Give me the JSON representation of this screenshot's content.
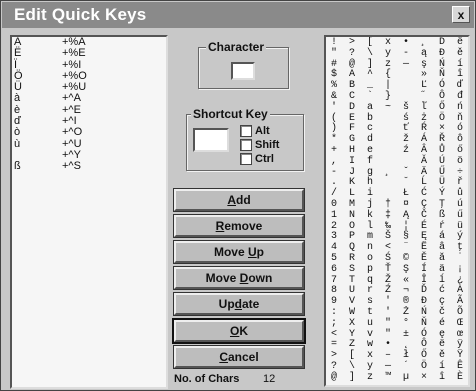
{
  "window": {
    "title": "Edit Quick Keys",
    "close_glyph": "x"
  },
  "quick_keys": [
    {
      "char": "Ä",
      "code": "+%A"
    },
    {
      "char": "Ë",
      "code": "+%E"
    },
    {
      "char": "Ï",
      "code": "+%I"
    },
    {
      "char": "Ö",
      "code": "+%O"
    },
    {
      "char": "Ü",
      "code": "+%U"
    },
    {
      "char": "à",
      "code": "+^A"
    },
    {
      "char": "è",
      "code": "+^E"
    },
    {
      "char": "ď",
      "code": "+^I"
    },
    {
      "char": "ò",
      "code": "+^O"
    },
    {
      "char": "ù",
      "code": "+^U"
    },
    {
      "char": "",
      "code": "+^Y"
    },
    {
      "char": "ß",
      "code": "+^S"
    }
  ],
  "character_group": {
    "label": "Character",
    "value": ""
  },
  "shortcut_group": {
    "label": "Shortcut Key",
    "value": "",
    "checkboxes": [
      {
        "label": "Alt",
        "checked": false
      },
      {
        "label": "Shift",
        "checked": false
      },
      {
        "label": "Ctrl",
        "checked": false
      }
    ]
  },
  "buttons": {
    "add": {
      "u": "A",
      "rest": "dd"
    },
    "remove": {
      "u": "R",
      "rest": "emove"
    },
    "move_up": {
      "pre": "Move ",
      "u": "U",
      "rest": "p"
    },
    "move_down": {
      "pre": "Move ",
      "u": "D",
      "rest": "own"
    },
    "update": {
      "pre": "Up",
      "u": "d",
      "rest": "ate"
    },
    "ok": {
      "u": "O",
      "rest": "K"
    },
    "cancel": {
      "u": "C",
      "rest": "ancel"
    }
  },
  "char_count": {
    "label": "No. of Chars",
    "value": "12"
  },
  "character_grid": [
    [
      "!",
      "\"",
      "#",
      "$",
      "%",
      "&",
      "'",
      "(",
      ")",
      "*",
      "+",
      ",",
      "-",
      ".",
      "/",
      "0",
      "1",
      "2",
      "3",
      "4",
      "5",
      "6",
      "7",
      "8",
      "9",
      ":",
      ";",
      "<",
      "=",
      ">",
      "?",
      "@"
    ],
    [
      ">",
      "?",
      "@",
      "A",
      "B",
      "C",
      "D",
      "E",
      "F",
      "G",
      "H",
      "I",
      "J",
      "K",
      "L",
      "M",
      "N",
      "O",
      "P",
      "Q",
      "R",
      "S",
      "T",
      "U",
      "V",
      "W",
      "X",
      "Y",
      "Z",
      "[",
      "\\",
      "]"
    ],
    [
      "[",
      "\\",
      "]",
      "^",
      "_",
      "`",
      "a",
      "b",
      "c",
      "d",
      "e",
      "f",
      "g",
      "h",
      "i",
      "j",
      "k",
      "l",
      "m",
      "n",
      "o",
      "p",
      "q",
      "r",
      "s",
      "t",
      "u",
      "v",
      "w",
      "x",
      "y",
      "z"
    ],
    [
      "x",
      "y",
      "z",
      "{",
      "|",
      "}",
      "~",
      "",
      "",
      "",
      "",
      "",
      "¸",
      "",
      "",
      "†",
      "‡",
      "‰",
      "Š",
      "<",
      "Ś",
      "Ť",
      "Ž",
      "Ź",
      "'",
      "'",
      "\"",
      "\"",
      "•",
      "–",
      "—",
      "™"
    ],
    [
      "•",
      "-",
      "—",
      "",
      "",
      "",
      "š",
      "ś",
      "ť",
      "ž",
      "ź",
      "",
      "ˇ",
      "˘",
      "Ł",
      "¤",
      "Ą",
      "¦",
      "§",
      "¨",
      "©",
      "Ş",
      "«",
      "¬",
      "®",
      "Ż",
      "°",
      "±",
      "˛",
      "ł",
      "´",
      "µ"
    ],
    [
      "¸",
      "ą",
      "ş",
      "»",
      "Ľ",
      "˝",
      "ľ",
      "ż",
      "Ŕ",
      "Á",
      "Â",
      "Ă",
      "Ä",
      "Ĺ",
      "Ć",
      "Ç",
      "Č",
      "É",
      "Ę",
      "Ë",
      "Ě",
      "Í",
      "Î",
      "Ď",
      "Đ",
      "Ń",
      "Ň",
      "Ó",
      "Ô",
      "Ő",
      "Ö",
      "×"
    ],
    [
      "Ď",
      "Đ",
      "Ń",
      "Ň",
      "Ó",
      "Ô",
      "Ő",
      "Ö",
      "×",
      "Ř",
      "Ů",
      "Ú",
      "Ű",
      "Ü",
      "Ý",
      "Ţ",
      "ß",
      "ŕ",
      "á",
      "â",
      "ă",
      "ä",
      "ĺ",
      "ć",
      "ç",
      "č",
      "é",
      "ę",
      "ë",
      "ě",
      "í",
      "î"
    ],
    [
      "ë",
      "ě",
      "í",
      "î",
      "ď",
      "đ",
      "ń",
      "ň",
      "ó",
      "ô",
      "ő",
      "ö",
      "÷",
      "ř",
      "ů",
      "ú",
      "ű",
      "ü",
      "ý",
      "ţ",
      "˙",
      "¡",
      "¿",
      "À",
      "Ã",
      "Õ",
      "Œ",
      "œ",
      "ÿ",
      "Ÿ",
      "Ê",
      "È"
    ]
  ]
}
